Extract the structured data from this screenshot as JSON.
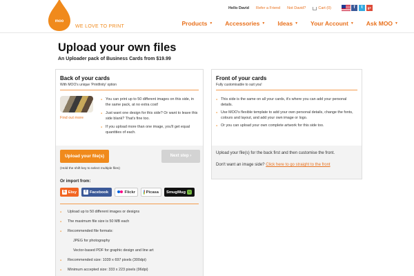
{
  "header": {
    "logo_text": "moo",
    "tagline": "WE LOVE TO PRINT",
    "hello": "Hello David",
    "refer": "Refer a Friend",
    "not_user": "Not David?",
    "cart": "Cart (0)",
    "social": {
      "facebook": "f",
      "twitter": "t",
      "googleplus": "g+"
    },
    "nav": [
      {
        "label": "Products"
      },
      {
        "label": "Accessories"
      },
      {
        "label": "Ideas"
      },
      {
        "label": "Your Account"
      },
      {
        "label": "Ask MOO"
      }
    ],
    "accent_color": "#f08a1c"
  },
  "page": {
    "title": "Upload your own files",
    "subtitle": "An Uploader pack of Business Cards from $19.99"
  },
  "back": {
    "title": "Back of your cards",
    "subtitle": "With MOO's unique 'Printfinity' option",
    "find_out": "Find out more",
    "bullets": [
      "You can print up to 50 different images on this side, in the same pack, at no extra cost!",
      "Just want one design for this side? Or want to leave this side blank? That's fine too.",
      "If you upload more than one image, you'll get equal quantities of each."
    ],
    "upload_label": "Upload your file(s)",
    "next_label": "Next step",
    "hold_note": "(Hold the shift key to select multiple files)",
    "or_import": "Or import from:",
    "import_sources": {
      "etsy": "Etsy",
      "facebook": "Facebook",
      "flickr": "Flickr",
      "picasa": "Picasa",
      "smugmug": "SmugMug"
    },
    "specs": [
      "Upload up to 50 different images or designs",
      "The maximum file size is 50 MB each",
      "Recommended file formats:",
      "JPEG for photography",
      "Vector-based PDF for graphic design and line art",
      "Recommended size: 1039 x 697 pixels (300dpi)",
      "Minimum accepted size: 333 x 223 pixels (96dpi)"
    ]
  },
  "front": {
    "title": "Front of your cards",
    "subtitle": "Fully customisable to suit you!",
    "bullets": [
      "This side is the same on all your cards, it's where you can add your personal details.",
      "Use MOO's flexible template to add your own personal details, change the fonts, colours and layout, and add your own image or logo.",
      "Or you can upload your own complete artwork for this side too."
    ],
    "note1": "Upload your file(s) for the back first and then customise the front.",
    "note2_prefix": "Don't want an image side?",
    "note2_link": "Click here to go straight to the front"
  }
}
